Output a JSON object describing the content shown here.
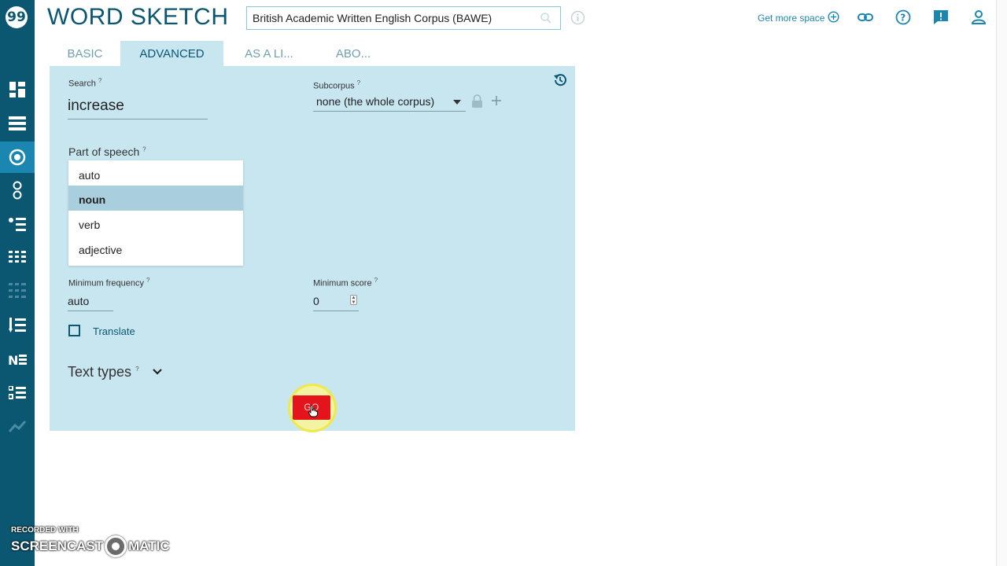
{
  "app": {
    "title": "WORD SKETCH",
    "logo_glyph": "99"
  },
  "header": {
    "corpus": "British Academic Written English Corpus (BAWE)",
    "more_space": "Get more space"
  },
  "sidebar": {
    "items": [
      {
        "icon": "dashboard-icon"
      },
      {
        "icon": "list-icon"
      },
      {
        "icon": "word-sketch-icon",
        "active": true
      },
      {
        "icon": "thesaurus-icon"
      },
      {
        "icon": "sketch-diff-icon"
      },
      {
        "icon": "concordance-icon"
      },
      {
        "icon": "parconc-icon"
      },
      {
        "icon": "wordlist-icon"
      },
      {
        "icon": "keywords-icon"
      },
      {
        "icon": "ngrams-icon"
      },
      {
        "icon": "trends-icon"
      }
    ]
  },
  "tabs": [
    {
      "label": "BASIC"
    },
    {
      "label": "ADVANCED",
      "active": true
    },
    {
      "label": "AS A LI..."
    },
    {
      "label": "ABO..."
    }
  ],
  "form": {
    "search_label": "Search",
    "search_value": "increase",
    "subcorpus_label": "Subcorpus",
    "subcorpus_value": "none (the whole corpus)",
    "pos_label": "Part of speech",
    "pos_options": [
      "auto",
      "noun",
      "verb",
      "adjective"
    ],
    "pos_selected": "noun",
    "minfreq_label": "Minimum frequency",
    "minfreq_value": "auto",
    "minscore_label": "Minimum score",
    "minscore_value": "0",
    "translate_label": "Translate",
    "text_types_label": "Text types",
    "help_mark": "?",
    "go_label": "GO"
  },
  "watermark": {
    "top": "RECORDED WITH",
    "left": "SCREENCAST",
    "right": "MATIC"
  },
  "colors": {
    "sidebar": "#0b5671",
    "panel": "#c8e6f0",
    "go": "#e3141b",
    "accent": "#1b86b0"
  }
}
